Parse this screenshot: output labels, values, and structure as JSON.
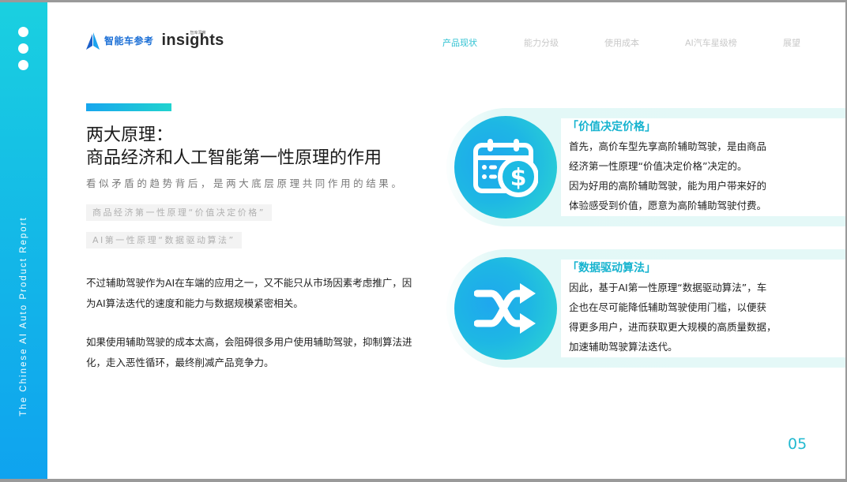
{
  "sidebar": {
    "vertical_text": "The Chinese AI Auto Product Report",
    "dots_icon": "more-dots-icon"
  },
  "header": {
    "logo_text": "智能车参考",
    "logo_icon": "logo-sail-icon",
    "insights_tagline": "智库洞察",
    "insights_text": "insights",
    "nav": [
      {
        "label": "产品现状",
        "active": true
      },
      {
        "label": "能力分级",
        "active": false
      },
      {
        "label": "使用成本",
        "active": false
      },
      {
        "label": "AI汽车星级榜",
        "active": false
      },
      {
        "label": "展望",
        "active": false
      }
    ]
  },
  "main": {
    "title_line1": "两大原理：",
    "title_line2": "商品经济和人工智能第一性原理的作用",
    "subtitle": "看似矛盾的趋势背后，是两大底层原理共同作用的结果。",
    "tag1": "商品经济第一性原理“价值决定价格”",
    "tag2": "AI第一性原理“数据驱动算法”",
    "para1": "不过辅助驾驶作为AI在车端的应用之一，又不能只从市场因素考虑推广，因为AI算法迭代的速度和能力与数据规模紧密相关。",
    "para2": "如果使用辅助驾驶的成本太高，会阻碍很多用户使用辅助驾驶，抑制算法进化，走入恶性循环，最终削减产品竞争力。"
  },
  "cards": [
    {
      "title": "「价值决定价格」",
      "icon": "calendar-dollar-icon",
      "lines": [
        "首先，高价车型先享高阶辅助驾驶，是由商品",
        "经济第一性原理“价值决定价格”决定的。",
        "因为好用的高阶辅助驾驶，能为用户带来好的",
        "体验感受到价值，愿意为高阶辅助驾驶付费。"
      ]
    },
    {
      "title": "「数据驱动算法」",
      "icon": "shuffle-icon",
      "lines": [
        "因此，基于AI第一性原理“数据驱动算法”，车",
        "企也在尽可能降低辅助驾驶使用门槛，以便获",
        "得更多用户，进而获取更大规模的高质量数据，",
        "加速辅助驾驶算法迭代。"
      ]
    }
  ],
  "footer": {
    "page_number": "05"
  },
  "colors": {
    "accent_cyan": "#2fc2d2",
    "accent_blue": "#17a6ee",
    "card_bg": "#e4f8f7"
  }
}
